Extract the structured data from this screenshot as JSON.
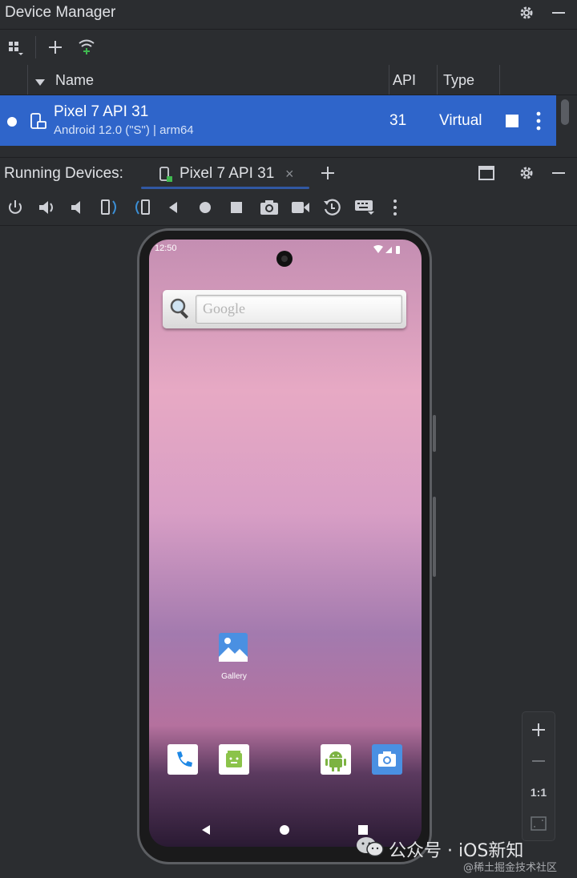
{
  "header": {
    "title": "Device Manager"
  },
  "columns": {
    "name": "Name",
    "api": "API",
    "type": "Type"
  },
  "device_row": {
    "name": "Pixel 7 API 31",
    "detail": "Android 12.0 (\"S\") | arm64",
    "api": "31",
    "type": "Virtual"
  },
  "running": {
    "label": "Running Devices:",
    "tab": "Pixel 7 API 31"
  },
  "phone": {
    "time": "12:50",
    "search_placeholder": "Google",
    "gallery_label": "Gallery"
  },
  "zoom": {
    "one_to_one": "1:1"
  },
  "watermark": {
    "main": "公众号 · iOS新知",
    "sub": "@稀土掘金技术社区"
  },
  "colors": {
    "selection": "#2f65ca",
    "panel": "#2b2d30",
    "accent_green": "#3fb950"
  }
}
